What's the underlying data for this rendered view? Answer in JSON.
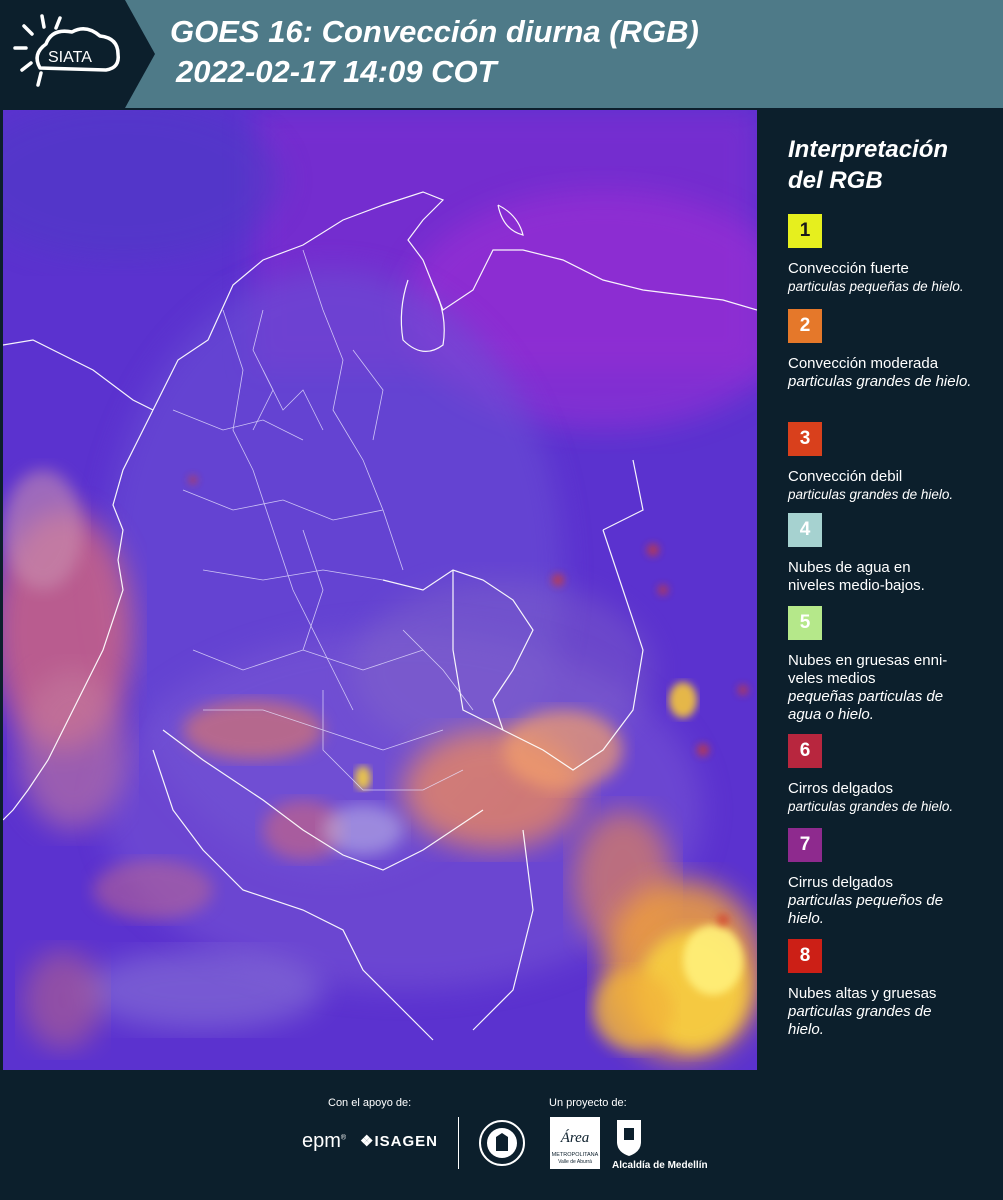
{
  "header": {
    "logo_text": "SIATA",
    "title_line1": "GOES 16: Convección diurna (RGB)",
    "title_line2": "2022-02-17 14:09 COT",
    "bg_color": "#4e7a88"
  },
  "legend": {
    "title": "Interpretación del RGB",
    "items": [
      {
        "number": "1",
        "color": "#e6ef1e",
        "text_color": "#1a1a1a",
        "title": "Convección fuerte",
        "desc": "particulas pequeñas de hielo."
      },
      {
        "number": "2",
        "color": "#e5782a",
        "text_color": "#ffffff",
        "title": "Convección moderada",
        "desc": "particulas grandes de hielo."
      },
      {
        "number": "3",
        "color": "#d9401c",
        "text_color": "#ffffff",
        "title": "Convección debil",
        "desc": "particulas grandes de hielo."
      },
      {
        "number": "4",
        "color": "#a6d2d0",
        "text_color": "#ffffff",
        "title": "Nubes de agua en niveles medio-bajos.",
        "desc": ""
      },
      {
        "number": "5",
        "color": "#b5e88a",
        "text_color": "#ffffff",
        "title": "Nubes en gruesas enni- veles medios",
        "desc": "pequeñas particulas de agua o hielo."
      },
      {
        "number": "6",
        "color": "#b8263e",
        "text_color": "#ffffff",
        "title": "Cirros delgados",
        "desc": "particulas grandes de hielo."
      },
      {
        "number": "7",
        "color": "#8e2a8e",
        "text_color": "#ffffff",
        "title": "Cirrus delgados",
        "desc": "particulas pequeños de hielo."
      },
      {
        "number": "8",
        "color": "#cc1f16",
        "text_color": "#ffffff",
        "title": "Nubes altas y gruesas",
        "desc": "particulas grandes de hielo."
      }
    ]
  },
  "footer": {
    "support_label": "Con el apoyo de:",
    "project_label": "Un proyecto de:",
    "epm": "epm",
    "epm_mark": "®",
    "isagen": "ISAGEN",
    "area_text": "Área",
    "area_sub": "METROPOLITANA",
    "area_sub2": "Valle de Aburrá",
    "alcaldia": "Alcaldía de Medellín"
  }
}
